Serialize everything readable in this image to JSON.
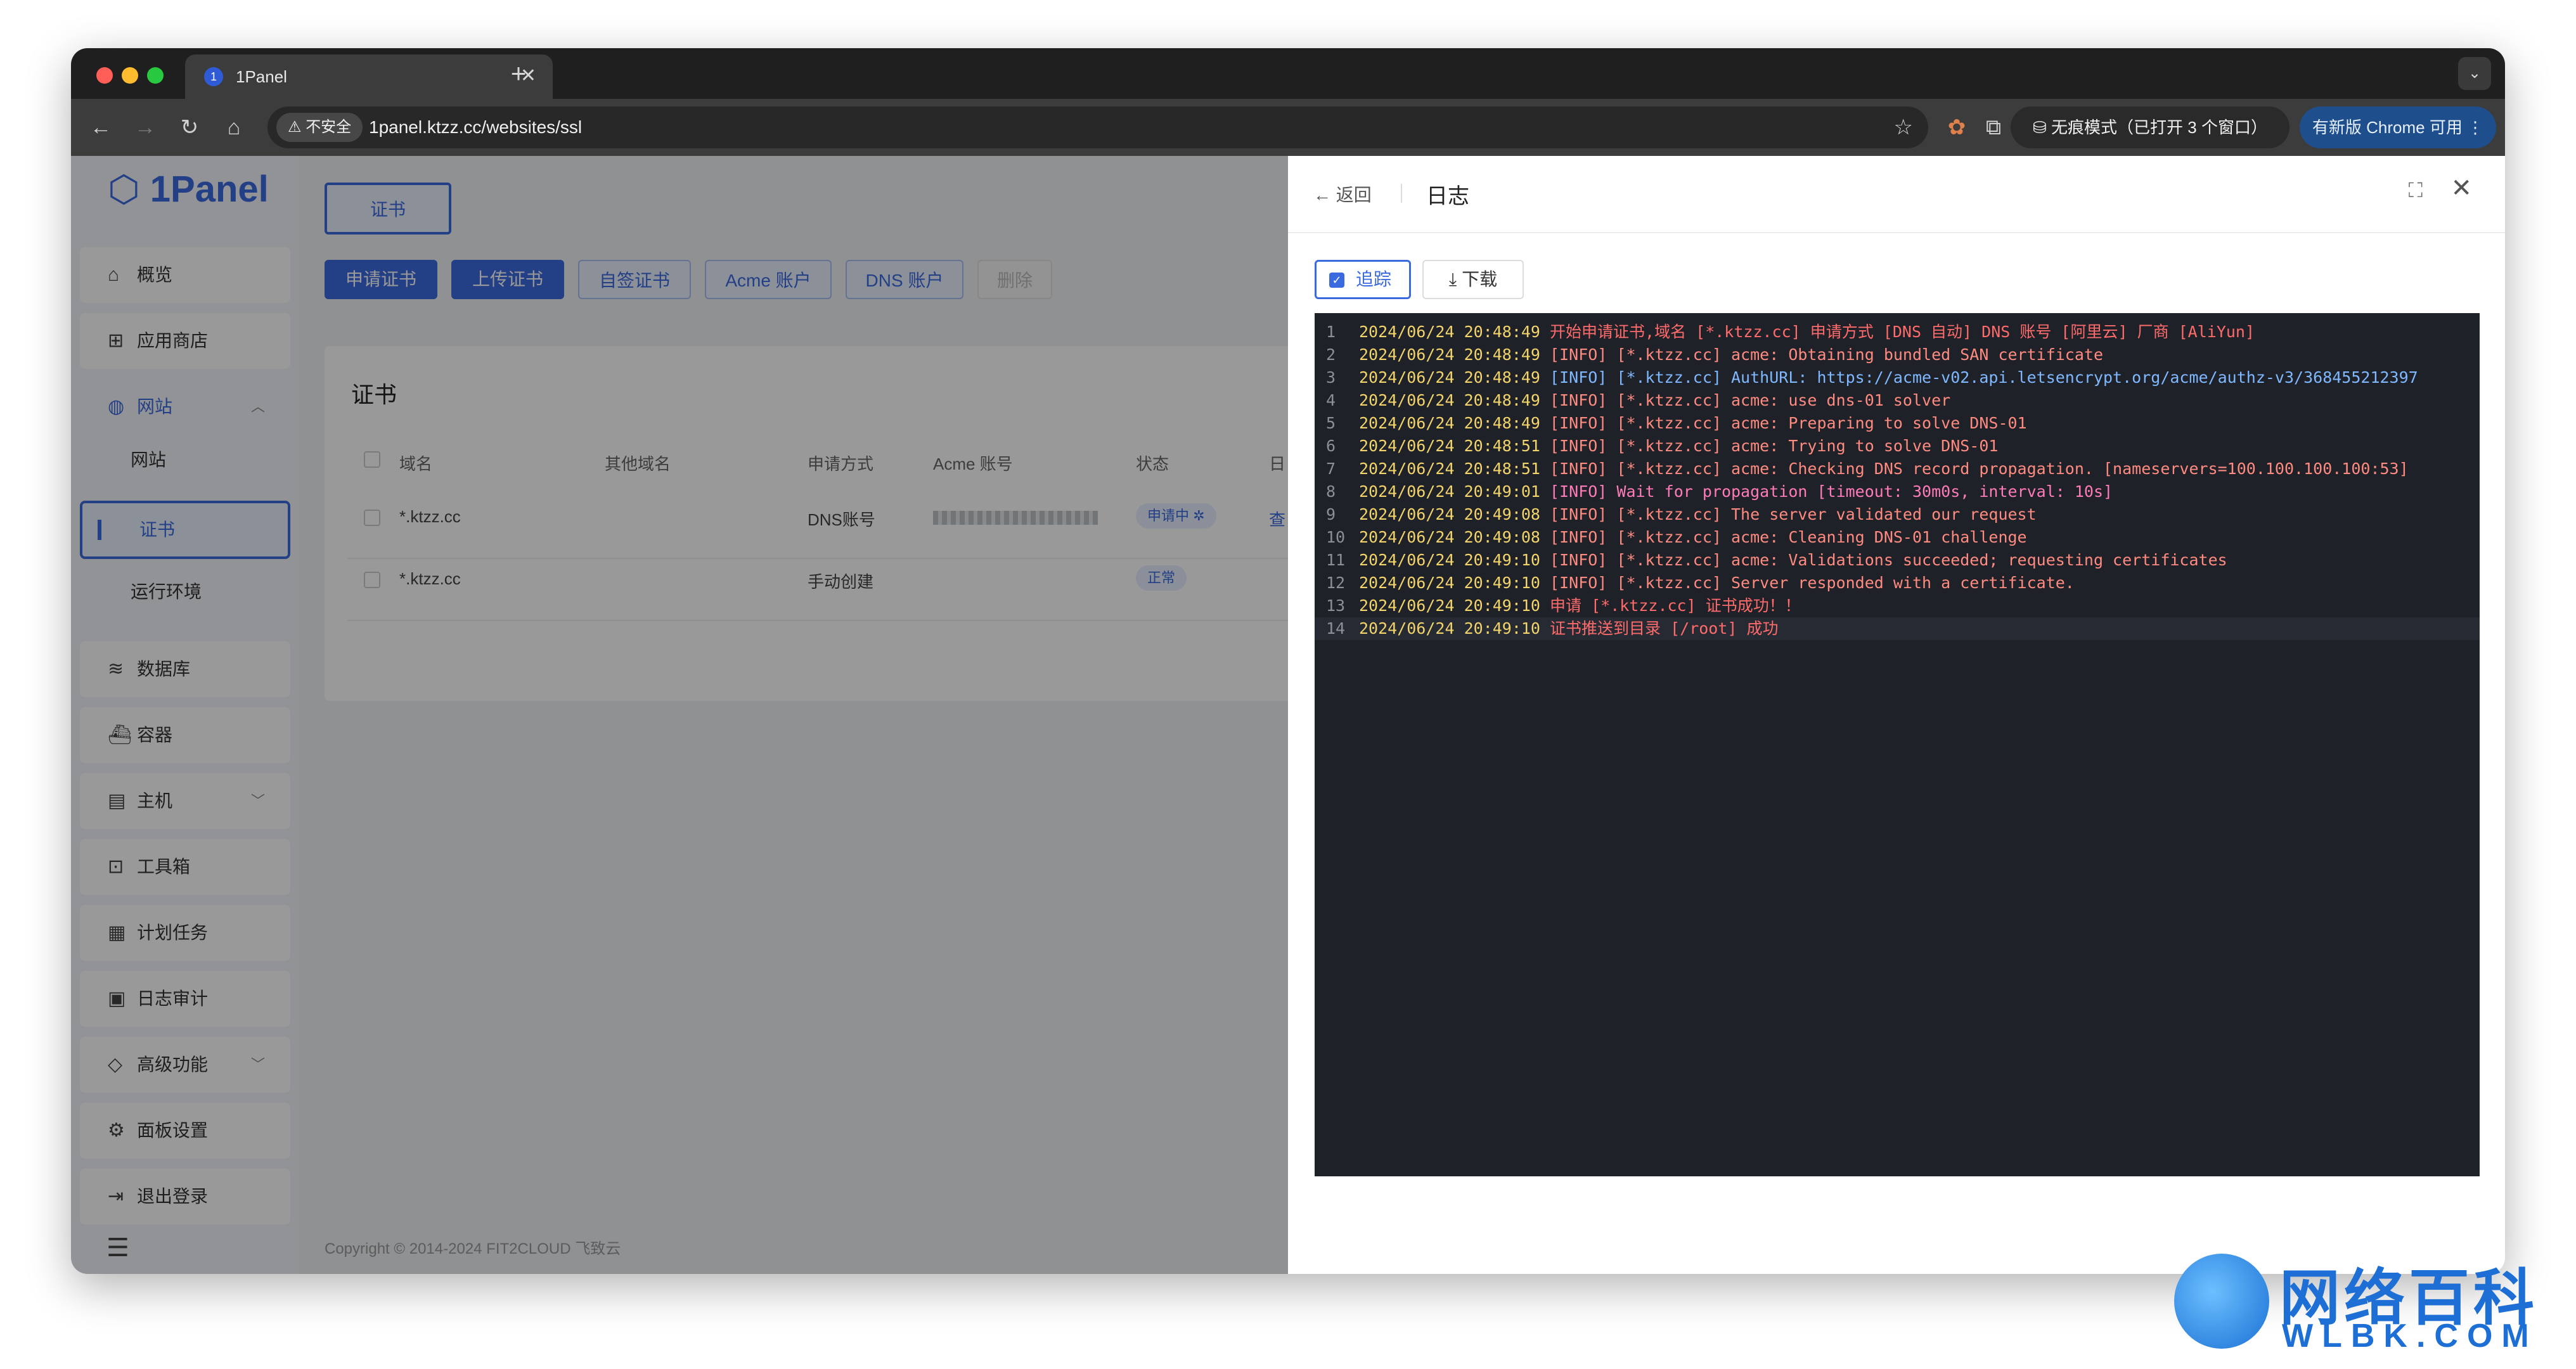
{
  "browser": {
    "tab_title": "1Panel",
    "tab_favicon": "1",
    "insecure_label": "不安全",
    "url": "1panel.ktzz.cc/websites/ssl",
    "incognito_label": "无痕模式（已打开 3 个窗口）",
    "update_label": "有新版 Chrome 可用"
  },
  "sidebar": {
    "logo": "1Panel",
    "items": [
      {
        "label": "概览",
        "icon": "home-icon"
      },
      {
        "label": "应用商店",
        "icon": "grid-icon"
      },
      {
        "label": "网站",
        "icon": "globe-icon"
      },
      {
        "label": "数据库",
        "icon": "layers-icon"
      },
      {
        "label": "容器",
        "icon": "docker-icon"
      },
      {
        "label": "主机",
        "icon": "server-icon"
      },
      {
        "label": "工具箱",
        "icon": "toolbox-icon"
      },
      {
        "label": "计划任务",
        "icon": "calendar-icon"
      },
      {
        "label": "日志审计",
        "icon": "log-icon"
      },
      {
        "label": "高级功能",
        "icon": "diamond-icon"
      },
      {
        "label": "面板设置",
        "icon": "gear-icon"
      },
      {
        "label": "退出登录",
        "icon": "logout-icon"
      }
    ],
    "website_sub": [
      "网站",
      "证书",
      "运行环境"
    ]
  },
  "main": {
    "top_tab": "证书",
    "actions": [
      "申请证书",
      "上传证书",
      "自签证书",
      "Acme 账户",
      "DNS 账户",
      "删除"
    ],
    "card_title": "证书",
    "columns": [
      "域名",
      "其他域名",
      "申请方式",
      "Acme 账号",
      "状态",
      "日"
    ],
    "rows": [
      {
        "domain": "*.ktzz.cc",
        "method": "DNS账号",
        "status": "申请中",
        "extra": "查"
      },
      {
        "domain": "*.ktzz.cc",
        "method": "手动创建",
        "status": "正常",
        "extra": ""
      }
    ],
    "footer": "Copyright © 2014-2024 FIT2CLOUD 飞致云"
  },
  "drawer": {
    "back_label": "返回",
    "title": "日志",
    "trace_label": "追踪",
    "download_label": "下载",
    "log_lines": [
      {
        "n": "1",
        "ts": "2024/06/24 20:48:49",
        "msg": " 开始申请证书,域名 [*.ktzz.cc] 申请方式 [DNS 自动] DNS 账号 [阿里云] 厂商 [AliYun]"
      },
      {
        "n": "2",
        "ts": "2024/06/24 20:48:49",
        "msg": " [INFO] [*.ktzz.cc] acme: Obtaining bundled SAN certificate"
      },
      {
        "n": "3",
        "ts": "2024/06/24 20:48:49",
        "msg": " [INFO] [*.ktzz.cc] AuthURL: https://acme-v02.api.letsencrypt.org/acme/authz-v3/368455212397"
      },
      {
        "n": "4",
        "ts": "2024/06/24 20:48:49",
        "msg": " [INFO] [*.ktzz.cc] acme: use dns-01 solver"
      },
      {
        "n": "5",
        "ts": "2024/06/24 20:48:49",
        "msg": " [INFO] [*.ktzz.cc] acme: Preparing to solve DNS-01"
      },
      {
        "n": "6",
        "ts": "2024/06/24 20:48:51",
        "msg": " [INFO] [*.ktzz.cc] acme: Trying to solve DNS-01"
      },
      {
        "n": "7",
        "ts": "2024/06/24 20:48:51",
        "msg": " [INFO] [*.ktzz.cc] acme: Checking DNS record propagation. [nameservers=100.100.100.100:53]"
      },
      {
        "n": "8",
        "ts": "2024/06/24 20:49:01",
        "msg": " [INFO] Wait for propagation [timeout: 30m0s, interval: 10s]"
      },
      {
        "n": "9",
        "ts": "2024/06/24 20:49:08",
        "msg": " [INFO] [*.ktzz.cc] The server validated our request"
      },
      {
        "n": "10",
        "ts": "2024/06/24 20:49:08",
        "msg": " [INFO] [*.ktzz.cc] acme: Cleaning DNS-01 challenge"
      },
      {
        "n": "11",
        "ts": "2024/06/24 20:49:10",
        "msg": " [INFO] [*.ktzz.cc] acme: Validations succeeded; requesting certificates"
      },
      {
        "n": "12",
        "ts": "2024/06/24 20:49:10",
        "msg": " [INFO] [*.ktzz.cc] Server responded with a certificate."
      },
      {
        "n": "13",
        "ts": "2024/06/24 20:49:10",
        "msg": " 申请 [*.ktzz.cc] 证书成功！！"
      },
      {
        "n": "14",
        "ts": "2024/06/24 20:49:10",
        "msg": " 证书推送到目录 [/root] 成功"
      }
    ]
  },
  "watermark": {
    "title": "网络百科",
    "sub": "WLBK.COM"
  },
  "colors": {
    "accent": "#3b6ae0",
    "log_bg": "#1e2128",
    "timestamp": "#f3d46b"
  }
}
